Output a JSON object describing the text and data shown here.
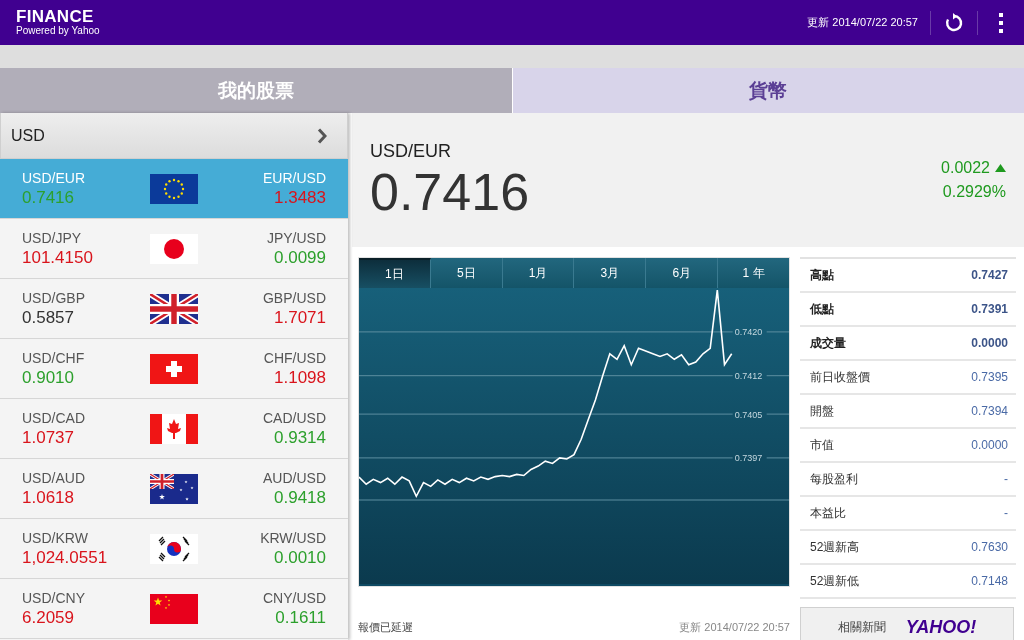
{
  "header": {
    "title": "FINANCE",
    "subtitle": "Powered by Yahoo",
    "updated": "更新 2014/07/22 20:57"
  },
  "tabs": [
    {
      "label": "我的股票",
      "selected": false
    },
    {
      "label": "貨幣",
      "selected": true
    }
  ],
  "currency_list": {
    "base": "USD",
    "rows": [
      {
        "kind": "eu",
        "selected": true,
        "left": {
          "pair": "USD/EUR",
          "rate": "0.7416",
          "color": "#2ca02c"
        },
        "right": {
          "pair": "EUR/USD",
          "rate": "1.3483",
          "color": "#d9141c"
        }
      },
      {
        "kind": "jp",
        "selected": false,
        "left": {
          "pair": "USD/JPY",
          "rate": "101.4150",
          "color": "#d9141c"
        },
        "right": {
          "pair": "JPY/USD",
          "rate": "0.0099",
          "color": "#2ca02c"
        }
      },
      {
        "kind": "gb",
        "selected": false,
        "left": {
          "pair": "USD/GBP",
          "rate": "0.5857",
          "color": "#333333"
        },
        "right": {
          "pair": "GBP/USD",
          "rate": "1.7071",
          "color": "#d9141c"
        }
      },
      {
        "kind": "ch",
        "selected": false,
        "left": {
          "pair": "USD/CHF",
          "rate": "0.9010",
          "color": "#2ca02c"
        },
        "right": {
          "pair": "CHF/USD",
          "rate": "1.1098",
          "color": "#d9141c"
        }
      },
      {
        "kind": "ca",
        "selected": false,
        "left": {
          "pair": "USD/CAD",
          "rate": "1.0737",
          "color": "#d9141c"
        },
        "right": {
          "pair": "CAD/USD",
          "rate": "0.9314",
          "color": "#2ca02c"
        }
      },
      {
        "kind": "au",
        "selected": false,
        "left": {
          "pair": "USD/AUD",
          "rate": "1.0618",
          "color": "#d9141c"
        },
        "right": {
          "pair": "AUD/USD",
          "rate": "0.9418",
          "color": "#2ca02c"
        }
      },
      {
        "kind": "kr",
        "selected": false,
        "left": {
          "pair": "USD/KRW",
          "rate": "1,024.0551",
          "color": "#d9141c"
        },
        "right": {
          "pair": "KRW/USD",
          "rate": "0.0010",
          "color": "#2ca02c"
        }
      },
      {
        "kind": "cn",
        "selected": false,
        "left": {
          "pair": "USD/CNY",
          "rate": "6.2059",
          "color": "#d9141c"
        },
        "right": {
          "pair": "CNY/USD",
          "rate": "0.1611",
          "color": "#2ca02c"
        }
      }
    ]
  },
  "detail": {
    "pair": "USD/EUR",
    "price": "0.7416",
    "change": "0.0022",
    "change_percent": "0.2929%",
    "change_up": true
  },
  "chart": {
    "periods": [
      {
        "label": "1日",
        "selected": true
      },
      {
        "label": "5日",
        "selected": false
      },
      {
        "label": "1月",
        "selected": false
      },
      {
        "label": "3月",
        "selected": false
      },
      {
        "label": "6月",
        "selected": false
      },
      {
        "label": "1 年",
        "selected": false
      }
    ],
    "chart_data": {
      "type": "line",
      "grid": true,
      "categories": [
        null,
        null,
        null,
        null,
        null,
        null,
        null,
        null,
        null,
        null,
        null,
        null,
        null,
        null,
        null,
        null,
        null,
        null,
        null,
        null,
        null,
        null,
        null,
        null,
        null,
        null,
        null,
        null,
        null,
        null,
        null,
        null,
        null,
        null,
        null,
        null,
        null,
        null,
        null,
        null,
        null,
        null,
        null,
        null,
        null,
        null,
        null,
        null,
        null,
        null,
        null,
        null,
        null,
        null,
        null,
        null,
        null,
        null,
        null,
        null,
        null
      ],
      "ylim": [
        0.7374,
        0.7428
      ],
      "yticks": [
        {
          "value": 0.7397,
          "label": "0.7397"
        },
        {
          "value": 0.7405,
          "label": "0.7405"
        },
        {
          "value": 0.7412,
          "label": "0.7412"
        },
        {
          "value": 0.742,
          "label": "0.7420"
        }
      ],
      "series": [
        {
          "color": "#ffffff",
          "values": [
            0.73935,
            0.73922,
            0.73931,
            0.73925,
            0.73933,
            0.73922,
            0.73935,
            0.73928,
            0.739,
            0.73925,
            0.73918,
            0.7393,
            0.73922,
            0.73931,
            0.73925,
            0.73933,
            0.73928,
            0.73935,
            0.73931,
            0.73936,
            0.73938,
            0.73936,
            0.7394,
            0.73938,
            0.73949,
            0.73955,
            0.73964,
            0.7396,
            0.7397,
            0.73968,
            0.73976,
            0.74004,
            0.7404,
            0.74076,
            0.7412,
            0.7416,
            0.7415,
            0.74175,
            0.7414,
            0.7417,
            0.74165,
            0.7416,
            0.74155,
            0.7416,
            0.7415,
            0.74158,
            0.7414,
            0.74145,
            0.7416,
            0.7417,
            0.74276,
            0.7414,
            0.7416,
            null,
            null,
            null,
            null,
            null,
            null,
            null,
            null
          ]
        }
      ]
    }
  },
  "stats": [
    {
      "label": "高點",
      "value": "0.7427",
      "emphasis": true
    },
    {
      "label": "低點",
      "value": "0.7391",
      "emphasis": true
    },
    {
      "label": "成交量",
      "value": "0.0000",
      "emphasis": true
    },
    {
      "label": "前日收盤價",
      "value": "0.7395",
      "emphasis": false
    },
    {
      "label": "開盤",
      "value": "0.7394",
      "emphasis": false
    },
    {
      "label": "市值",
      "value": "0.0000",
      "emphasis": false
    },
    {
      "label": "每股盈利",
      "value": "-",
      "emphasis": false
    },
    {
      "label": "本益比",
      "value": "-",
      "emphasis": false
    },
    {
      "label": "52週新高",
      "value": "0.7630",
      "emphasis": false
    },
    {
      "label": "52週新低",
      "value": "0.7148",
      "emphasis": false
    }
  ],
  "footer": {
    "notice": "報價已延遲",
    "updated": "更新 2014/07/22 20:57",
    "news_button": "相關新聞",
    "news_logo": "YAHOO!"
  }
}
